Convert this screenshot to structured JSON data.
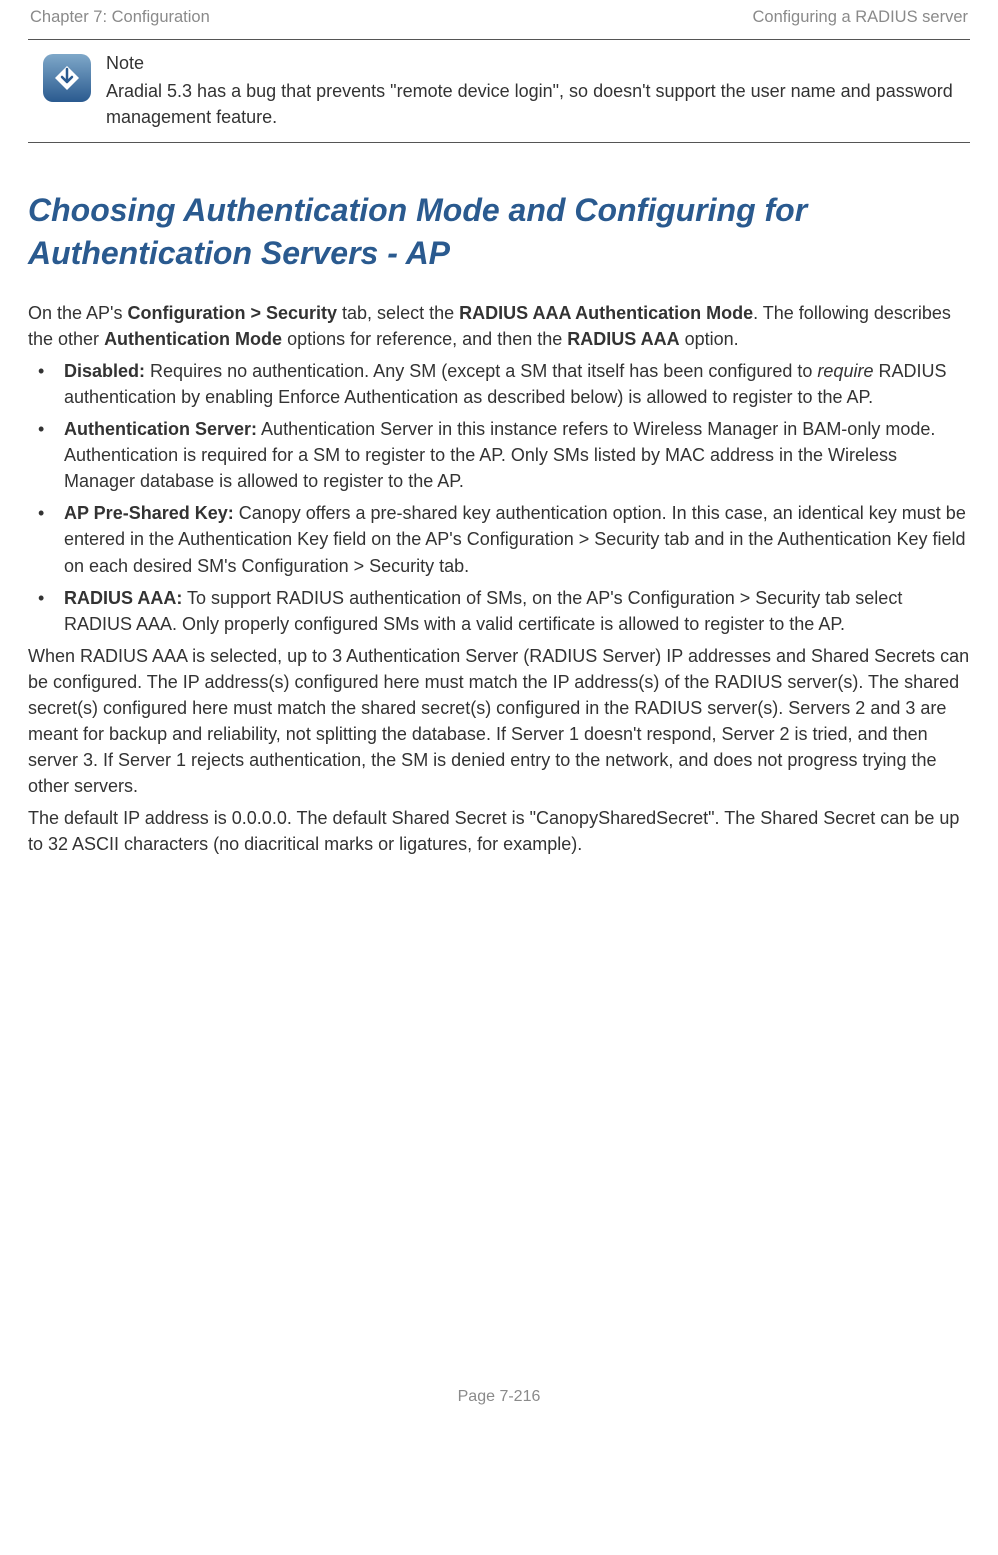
{
  "header": {
    "left": "Chapter 7:  Configuration",
    "right": "Configuring a RADIUS server"
  },
  "note": {
    "title": "Note",
    "body": "Aradial 5.3 has a bug that prevents \"remote device login\", so doesn't support the user name and password management feature."
  },
  "section_title": "Choosing Authentication Mode and Configuring for Authentication Servers - AP",
  "intro": {
    "pre": "On the AP's ",
    "bold1": "Configuration > Security",
    "mid1": " tab, select the ",
    "bold2": "RADIUS AAA Authentication Mode",
    "mid2": ". The following describes the other ",
    "bold3": "Authentication Mode",
    "mid3": " options for reference, and then the ",
    "bold4": "RADIUS AAA",
    "end": " option."
  },
  "options": [
    {
      "label": "Disabled:",
      "pre": " Requires no authentication. Any SM (except a SM that itself has been configured to ",
      "italic": "require",
      "post": " RADIUS authentication by enabling Enforce Authentication as described below) is allowed to register to the AP."
    },
    {
      "label": "Authentication Server:",
      "text": " Authentication Server in this instance refers to Wireless Manager in BAM-only mode. Authentication is required for a SM to register to the AP. Only SMs listed by MAC address in the Wireless Manager database is allowed to register to the AP."
    },
    {
      "label": "AP Pre-Shared Key:",
      "text": " Canopy offers a pre-shared key authentication option. In this case, an identical key must be entered in the Authentication Key field on the AP's Configuration > Security tab and in the Authentication Key field on each desired SM's Configuration > Security tab."
    },
    {
      "label": "RADIUS AAA:",
      "text": " To support RADIUS authentication of SMs, on the AP's Configuration > Security tab select RADIUS AAA. Only properly configured SMs with a valid certificate is allowed to register to the AP."
    }
  ],
  "para2": "When RADIUS AAA is selected, up to 3 Authentication Server (RADIUS Server) IP addresses and Shared Secrets can be configured. The IP address(s) configured here must match the IP address(s) of the RADIUS server(s). The shared secret(s) configured here must match the shared secret(s) configured in the RADIUS server(s). Servers 2 and 3 are meant for backup and reliability, not splitting the database. If Server 1 doesn't respond, Server 2 is tried, and then server 3. If Server 1 rejects authentication, the SM is denied entry to the network, and does not progress trying the other servers.",
  "para3": "The default IP address is 0.0.0.0. The default Shared Secret is \"CanopySharedSecret\". The Shared Secret can be up to 32 ASCII characters (no diacritical marks or ligatures, for example).",
  "footer": "Page 7-216"
}
